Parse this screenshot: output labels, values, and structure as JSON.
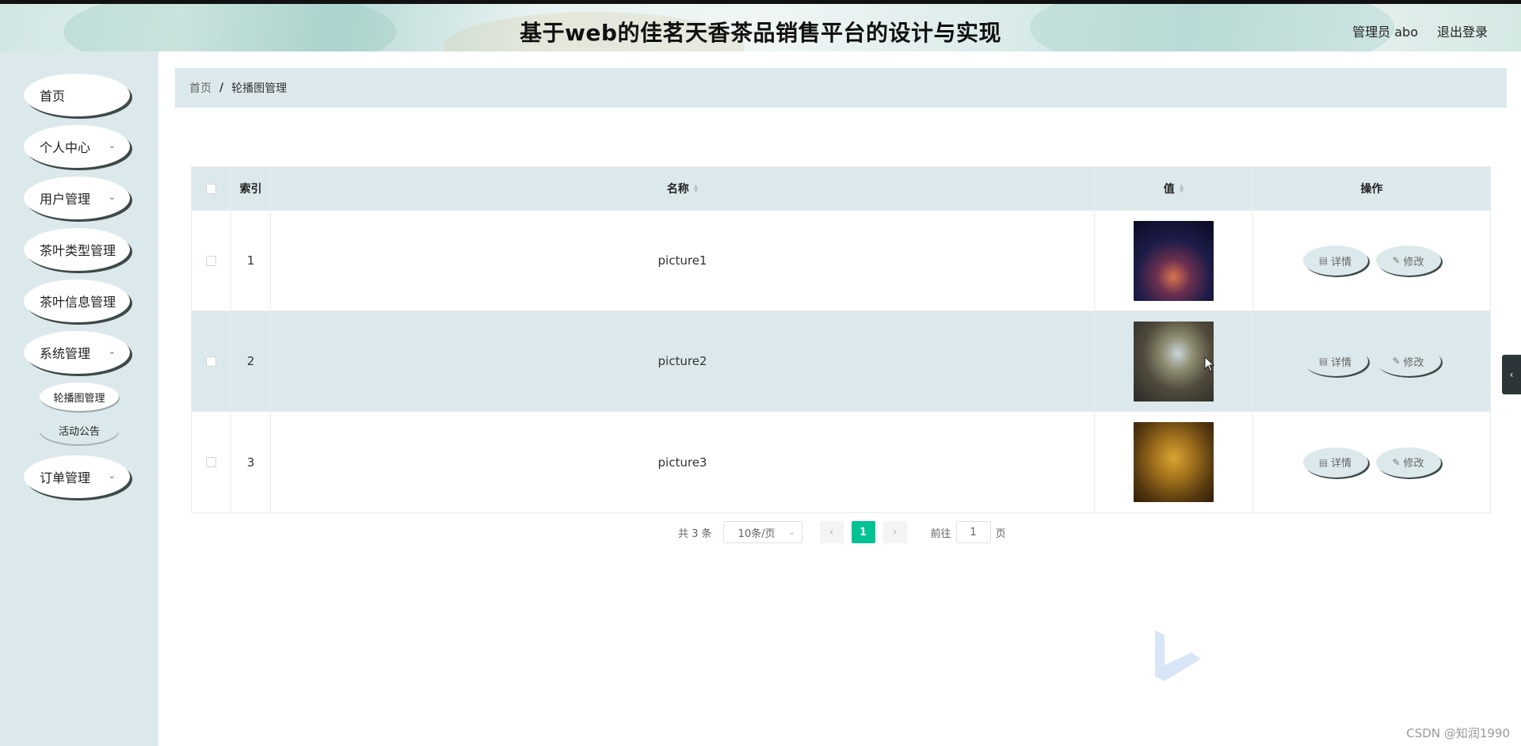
{
  "header": {
    "title": "基于web的佳茗天香茶品销售平台的设计与实现",
    "user_label": "管理员 abo",
    "logout_label": "退出登录"
  },
  "sidebar": {
    "items": [
      {
        "label": "首页",
        "has_children": false
      },
      {
        "label": "个人中心",
        "has_children": true
      },
      {
        "label": "用户管理",
        "has_children": true
      },
      {
        "label": "茶叶类型管理",
        "has_children": false
      },
      {
        "label": "茶叶信息管理",
        "has_children": false
      },
      {
        "label": "系统管理",
        "has_children": true
      },
      {
        "label": "订单管理",
        "has_children": true
      }
    ],
    "submenu": [
      {
        "label": "轮播图管理",
        "active": true
      },
      {
        "label": "活动公告",
        "active": false
      }
    ]
  },
  "breadcrumb": {
    "home": "首页",
    "separator": "/",
    "current": "轮播图管理"
  },
  "table": {
    "columns": {
      "index": "索引",
      "name": "名称",
      "value": "值",
      "ops": "操作"
    },
    "rows": [
      {
        "index": "1",
        "name": "picture1",
        "detail": "详情",
        "edit": "修改"
      },
      {
        "index": "2",
        "name": "picture2",
        "detail": "详情",
        "edit": "修改"
      },
      {
        "index": "3",
        "name": "picture3",
        "detail": "详情",
        "edit": "修改"
      }
    ]
  },
  "pagination": {
    "total_text": "共 3 条",
    "page_size": "10条/页",
    "current_page": "1",
    "goto_prefix": "前往",
    "goto_value": "1",
    "goto_suffix": "页"
  },
  "credit": "CSDN @知润1990",
  "colors": {
    "accent": "#00c292",
    "panel": "#dce9ec",
    "shadow": "#3e4a4a"
  }
}
